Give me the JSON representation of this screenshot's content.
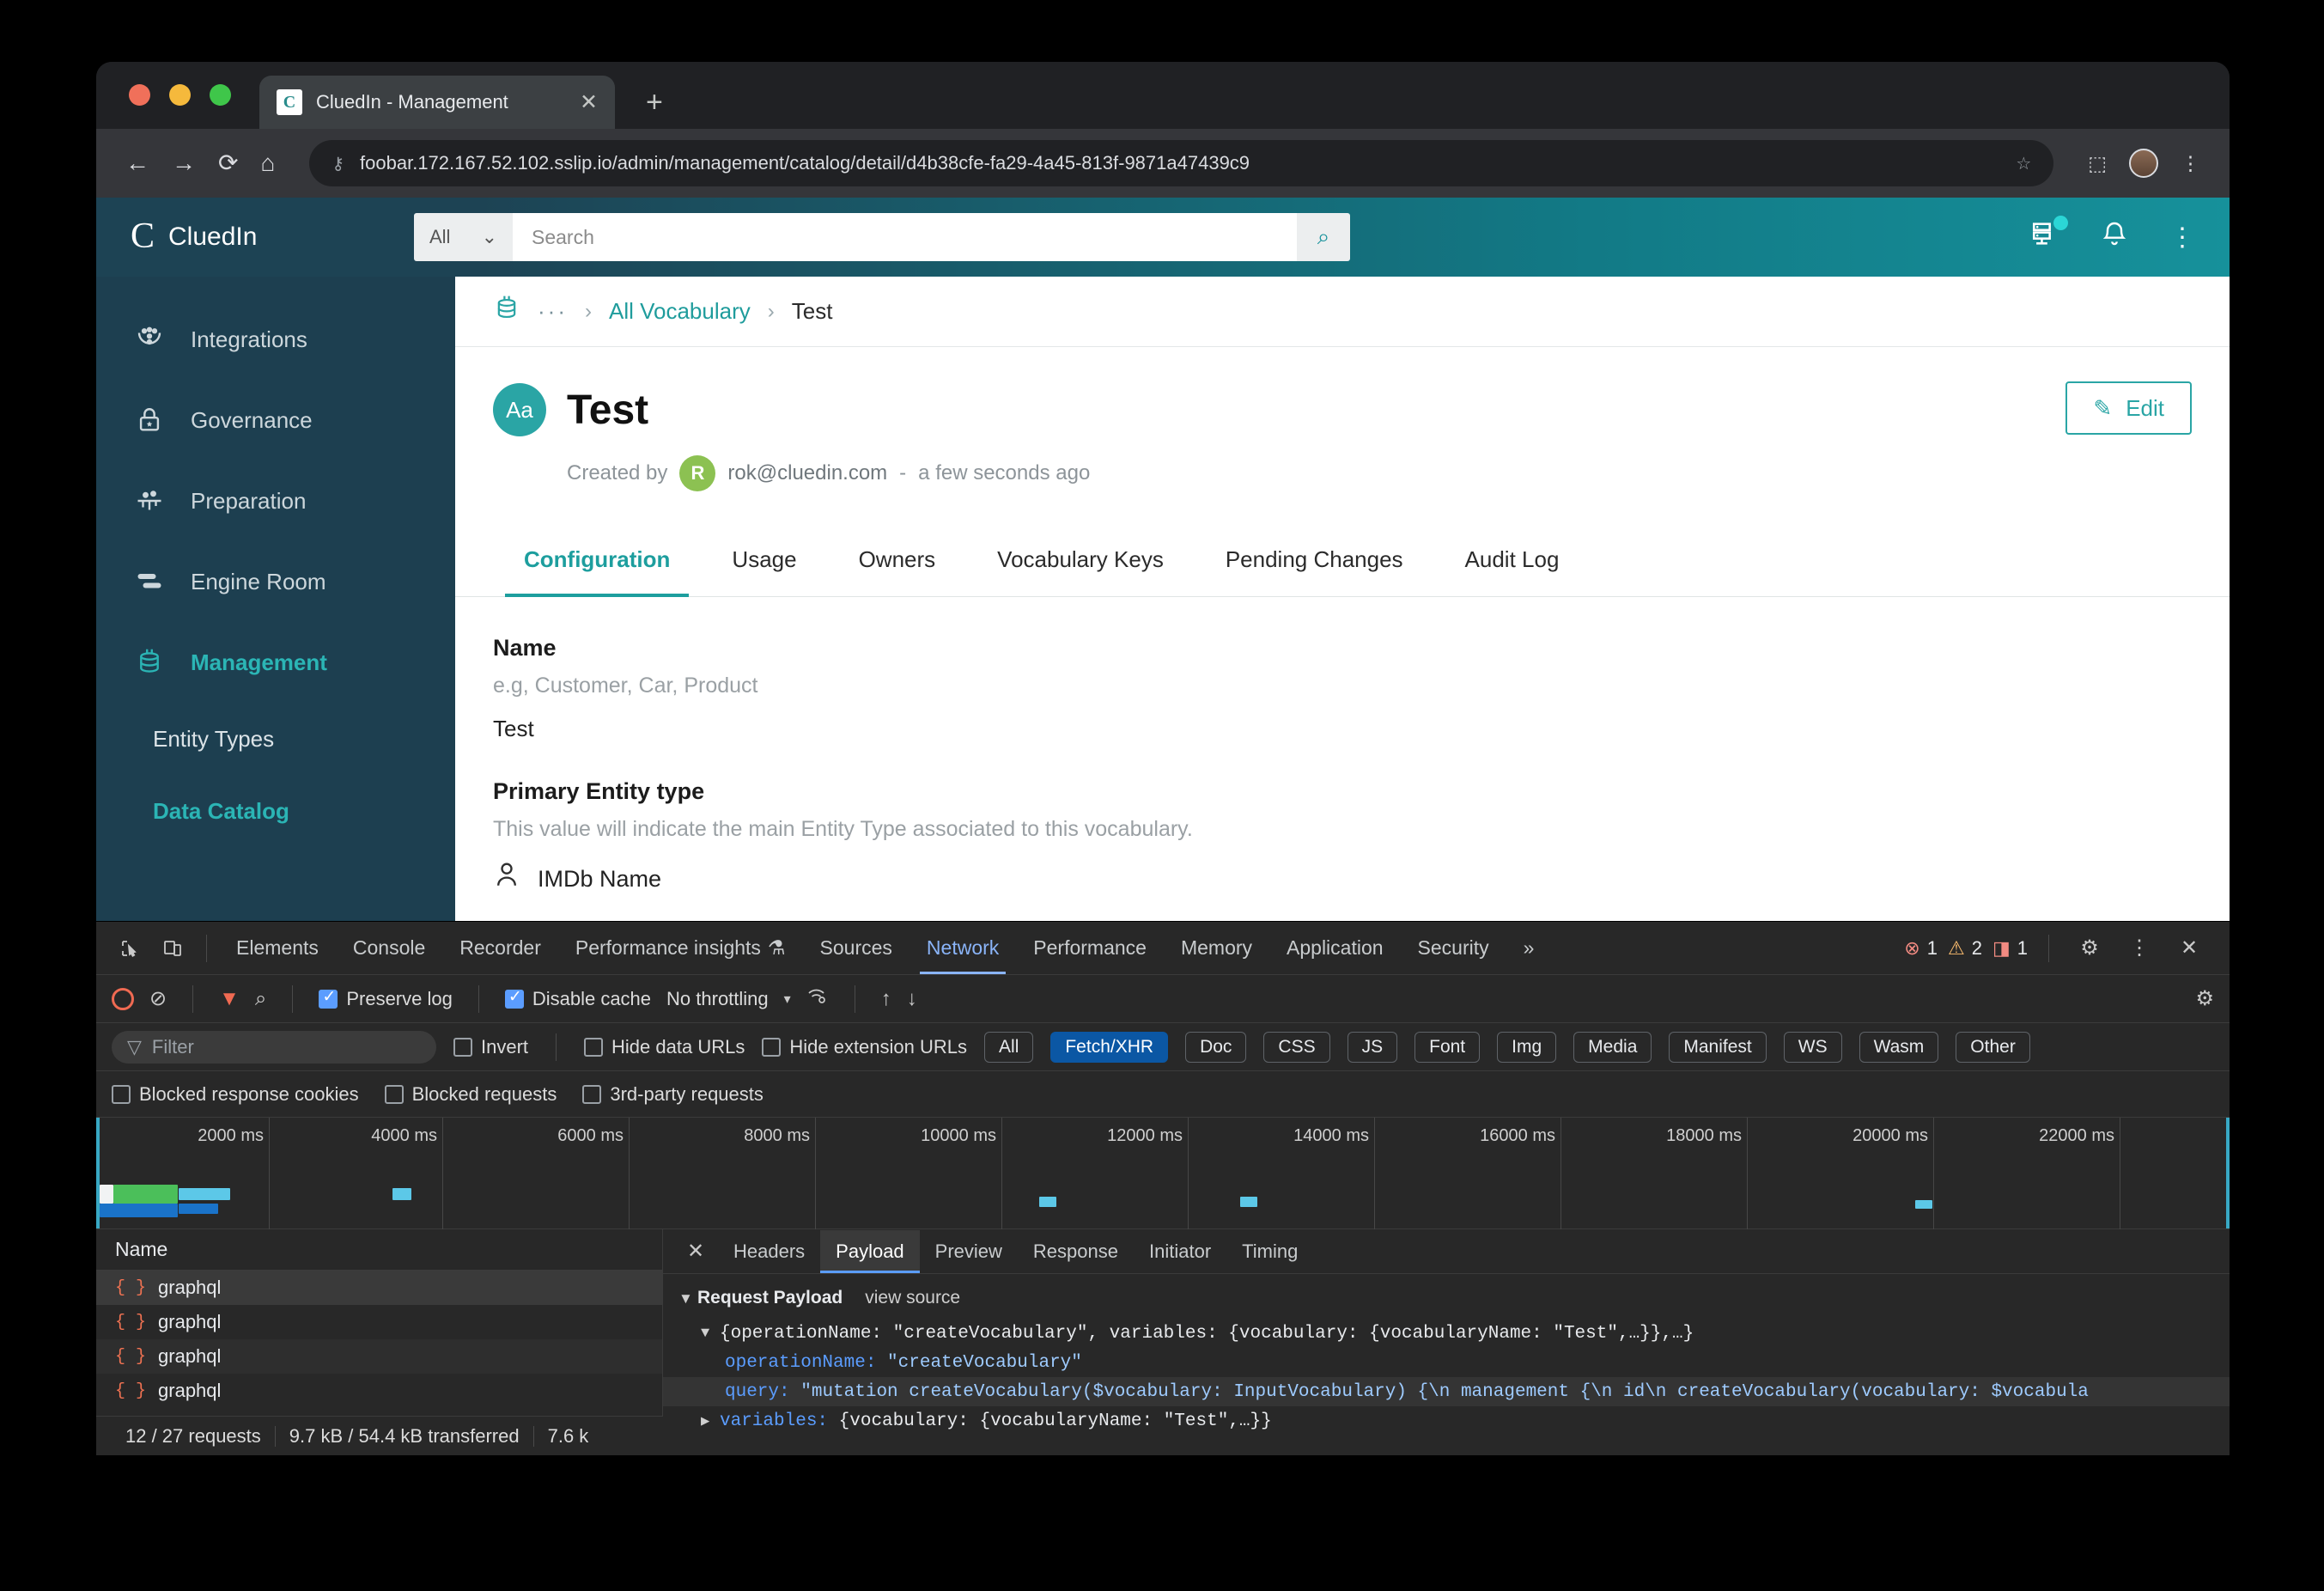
{
  "browser": {
    "tab": {
      "title": "CluedIn - Management",
      "favicon_letter": "C",
      "close_label": "✕"
    },
    "new_tab_label": "+",
    "nav": {
      "back": "←",
      "forward": "→",
      "reload": "⟳",
      "home": "⌂"
    },
    "omnibox": {
      "url": "foobar.172.167.52.102.sslip.io/admin/management/catalog/detail/d4b38cfe-fa29-4a45-813f-9871a47439c9",
      "permission_icon": "⚷",
      "bookmark_icon": "☆"
    },
    "toolbar_right": {
      "extensions": "⬚",
      "menu": "⋮"
    }
  },
  "app": {
    "brand": {
      "mark": "C",
      "name": "CluedIn"
    },
    "search": {
      "scope": "All",
      "scope_caret": "⌄",
      "placeholder": "Search",
      "go_icon": "⌕"
    },
    "header_icons": {
      "server": "🖧",
      "bell": "🔔",
      "more": "⋮"
    },
    "sidebar": {
      "items": [
        {
          "label": "Integrations",
          "icon": "⁖",
          "active": false
        },
        {
          "label": "Governance",
          "icon": "🔒",
          "active": false
        },
        {
          "label": "Preparation",
          "icon": "⚯",
          "active": false
        },
        {
          "label": "Engine Room",
          "icon": "⇥",
          "active": false
        },
        {
          "label": "Management",
          "icon": "⛁",
          "active": true
        }
      ],
      "sub_items": [
        {
          "label": "Entity Types",
          "active": false
        },
        {
          "label": "Data Catalog",
          "active": true
        }
      ]
    },
    "breadcrumb": {
      "icon": "⛁",
      "ellipsis": "···",
      "separator": "›",
      "link": "All Vocabulary",
      "current": "Test"
    },
    "page": {
      "badge_icon": "Aa",
      "title": "Test",
      "created_by_label": "Created by",
      "author_initial": "R",
      "author_email": "rok@cluedin.com",
      "dash": "-",
      "created_ago": "a few seconds ago",
      "edit_button": "Edit",
      "edit_icon": "✎"
    },
    "tabs": [
      {
        "label": "Configuration",
        "active": true
      },
      {
        "label": "Usage",
        "active": false
      },
      {
        "label": "Owners",
        "active": false
      },
      {
        "label": "Vocabulary Keys",
        "active": false
      },
      {
        "label": "Pending Changes",
        "active": false
      },
      {
        "label": "Audit Log",
        "active": false
      }
    ],
    "form": {
      "name_label": "Name",
      "name_hint": "e.g, Customer, Car, Product",
      "name_value": "Test",
      "entity_label": "Primary Entity type",
      "entity_hint": "This value will indicate the main Entity Type associated to this vocabulary.",
      "entity_icon": "person-icon",
      "entity_value": "IMDb Name"
    }
  },
  "devtools": {
    "panels": [
      {
        "label": "Elements",
        "active": false
      },
      {
        "label": "Console",
        "active": false
      },
      {
        "label": "Recorder",
        "active": false
      },
      {
        "label": "Performance insights",
        "active": false,
        "suffix": "⚗"
      },
      {
        "label": "Sources",
        "active": false
      },
      {
        "label": "Network",
        "active": true
      },
      {
        "label": "Performance",
        "active": false
      },
      {
        "label": "Memory",
        "active": false
      },
      {
        "label": "Application",
        "active": false
      },
      {
        "label": "Security",
        "active": false
      }
    ],
    "overflow": "»",
    "counts": {
      "errors": "1",
      "warnings": "2",
      "issues": "1"
    },
    "settings_icon": "⚙",
    "more_icon": "⋮",
    "close_icon": "✕",
    "toolbar": {
      "record_tooltip": "record",
      "clear_icon": "⊘",
      "filter_icon": "▼",
      "search_icon": "⌕",
      "preserve_log": "Preserve log",
      "preserve_log_checked": true,
      "disable_cache": "Disable cache",
      "disable_cache_checked": true,
      "throttling": "No throttling",
      "throttle_caret": "▾",
      "wifi_icon": "◠",
      "import_icon": "↑",
      "export_icon": "↓"
    },
    "filterbar": {
      "filter_placeholder": "Filter",
      "filter_icon": "▽",
      "invert": "Invert",
      "hide_data_urls": "Hide data URLs",
      "hide_extension_urls": "Hide extension URLs",
      "types": [
        {
          "label": "All",
          "active": false
        },
        {
          "label": "Fetch/XHR",
          "active": true
        },
        {
          "label": "Doc",
          "active": false
        },
        {
          "label": "CSS",
          "active": false
        },
        {
          "label": "JS",
          "active": false
        },
        {
          "label": "Font",
          "active": false
        },
        {
          "label": "Img",
          "active": false
        },
        {
          "label": "Media",
          "active": false
        },
        {
          "label": "Manifest",
          "active": false
        },
        {
          "label": "WS",
          "active": false
        },
        {
          "label": "Wasm",
          "active": false
        },
        {
          "label": "Other",
          "active": false
        }
      ],
      "blocked_response_cookies": "Blocked response cookies",
      "blocked_requests": "Blocked requests",
      "third_party_requests": "3rd-party requests"
    },
    "timeline": {
      "ticks": [
        "2000 ms",
        "4000 ms",
        "6000 ms",
        "8000 ms",
        "10000 ms",
        "12000 ms",
        "14000 ms",
        "16000 ms",
        "18000 ms",
        "20000 ms",
        "22000 ms"
      ]
    },
    "requests": {
      "column_header": "Name",
      "rows": [
        {
          "name": "graphql",
          "icon": "{ }",
          "selected": true
        },
        {
          "name": "graphql",
          "icon": "{ }",
          "selected": false
        },
        {
          "name": "graphql",
          "icon": "{ }",
          "selected": false
        },
        {
          "name": "graphql",
          "icon": "{ }",
          "selected": false
        }
      ]
    },
    "status": {
      "requests": "12 / 27 requests",
      "transferred": "9.7 kB / 54.4 kB transferred",
      "resources": "7.6 k"
    },
    "detail": {
      "close_icon": "✕",
      "tabs": [
        {
          "label": "Headers",
          "active": false
        },
        {
          "label": "Payload",
          "active": true
        },
        {
          "label": "Preview",
          "active": false
        },
        {
          "label": "Response",
          "active": false
        },
        {
          "label": "Initiator",
          "active": false
        },
        {
          "label": "Timing",
          "active": false
        }
      ],
      "payload": {
        "section_title": "Request Payload",
        "view_source": "view source",
        "root_collapse": "▼",
        "root_line": "{operationName: \"createVocabulary\", variables: {vocabulary: {vocabularyName: \"Test\",…}},…}",
        "operation_key": "operationName:",
        "operation_value": "\"createVocabulary\"",
        "query_key": "query:",
        "query_value": "\"mutation createVocabulary($vocabulary: InputVocabulary) {\\n  management {\\n    id\\n      createVocabulary(vocabulary: $vocabula",
        "variables_expand": "▶",
        "variables_key": "variables:",
        "variables_value": "{vocabulary: {vocabularyName: \"Test\",…}}"
      }
    }
  }
}
